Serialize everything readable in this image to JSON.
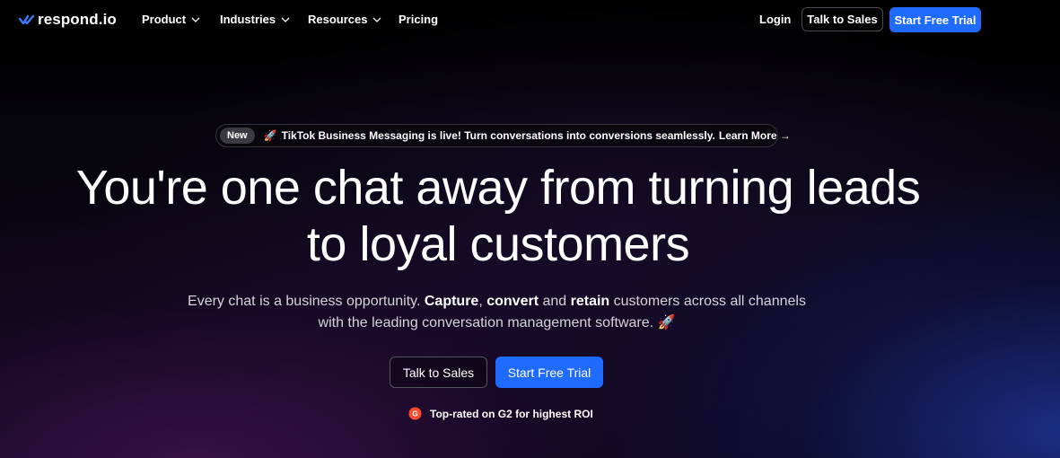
{
  "nav": {
    "logo_text": "respond.io",
    "items": [
      {
        "label": "Product",
        "has_dropdown": true
      },
      {
        "label": "Industries",
        "has_dropdown": true
      },
      {
        "label": "Resources",
        "has_dropdown": true
      },
      {
        "label": "Pricing",
        "has_dropdown": false
      }
    ],
    "login": "Login",
    "talk_to_sales": "Talk to Sales",
    "start_free_trial": "Start Free Trial"
  },
  "announcement": {
    "badge": "New",
    "icon": "🚀",
    "text": "TikTok Business Messaging is live! Turn conversations into conversions seamlessly.",
    "link": "Learn More →"
  },
  "hero": {
    "headline_line1": "You're one chat away from turning leads",
    "headline_line2": "to loyal customers",
    "sub": {
      "part1": "Every chat is a business opportunity. ",
      "capture": "Capture",
      "part2": ", ",
      "convert": "convert",
      "part3": " and ",
      "retain": "retain",
      "part4": " customers across all channels with the leading conversation management software. ",
      "emoji": "🚀"
    },
    "cta_secondary": "Talk to Sales",
    "cta_primary": "Start Free Trial",
    "rating_text": "Top-rated on G2 for highest ROI"
  },
  "colors": {
    "accent": "#1f6bff",
    "background": "#000000",
    "g2_brand": "#ff492c"
  }
}
